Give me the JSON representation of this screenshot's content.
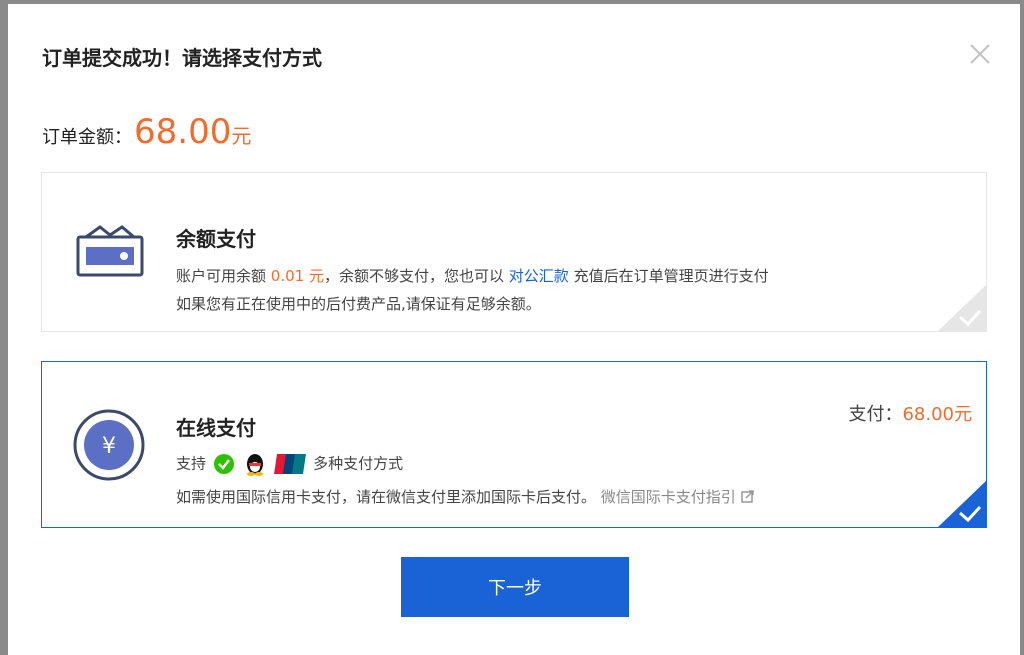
{
  "dialog": {
    "title": "订单提交成功！请选择支付方式",
    "amount_label": "订单金额：",
    "amount_value": "68.00",
    "amount_unit": "元"
  },
  "balance_payment": {
    "title": "余额支付",
    "line1_prefix": "账户可用余额",
    "available_balance": "0.01 元",
    "line1_middle": "，余额不够支付，您也可以",
    "transfer_link": "对公汇款",
    "line1_suffix": "充值后在订单管理页进行支付",
    "line2": "如果您有正在使用中的后付费产品,请保证有足够余额。",
    "selected": false
  },
  "online_payment": {
    "title": "在线支付",
    "support_label": "支持",
    "methods_text": "多种支付方式",
    "note": "如需使用国际信用卡支付，请在微信支付里添加国际卡后支付。",
    "guide_link": "微信国际卡支付指引",
    "pay_label": "支付：",
    "pay_amount": "68.00元",
    "selected": true,
    "brands": [
      "wechat-pay-icon",
      "qq-pay-icon",
      "unionpay-icon"
    ]
  },
  "next_button": "下一步",
  "colors": {
    "accent": "#1a63d6",
    "price": "#f36b2b"
  }
}
